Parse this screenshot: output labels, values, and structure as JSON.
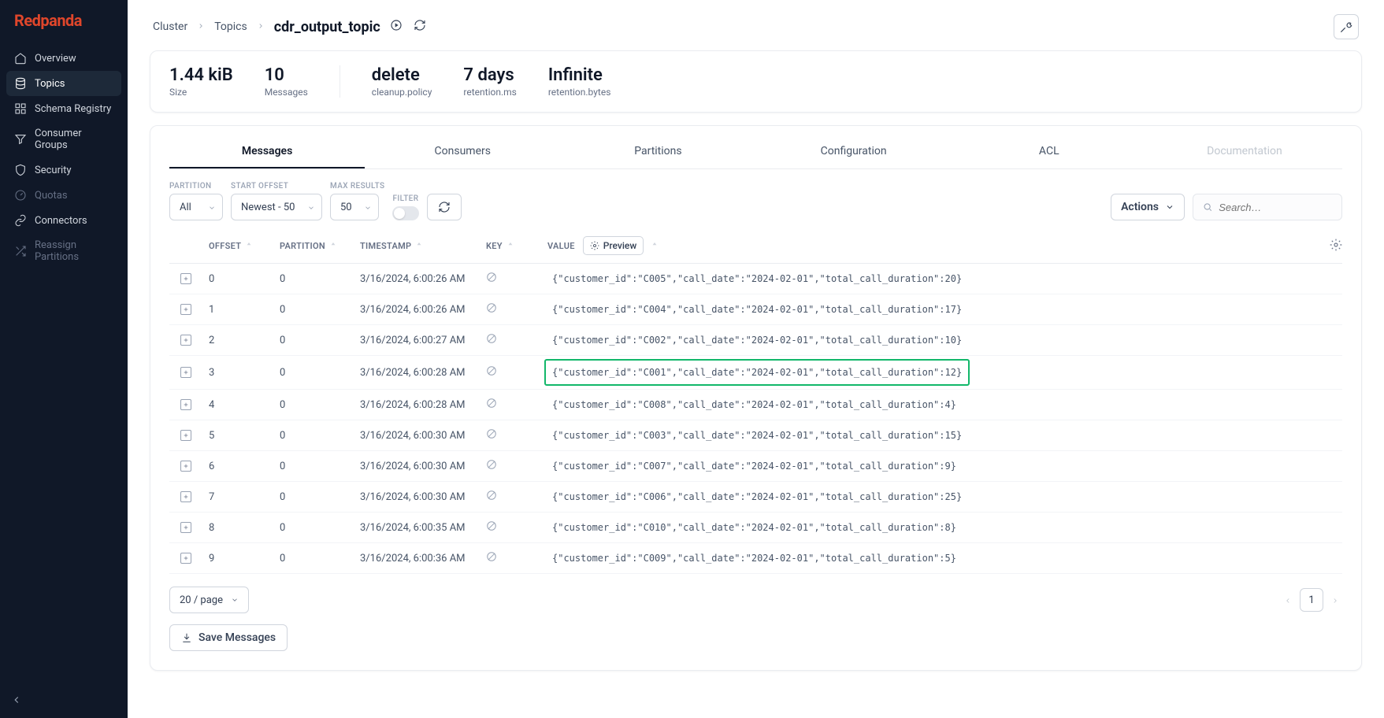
{
  "logo": "Redpanda",
  "sidebar": {
    "items": [
      {
        "label": "Overview",
        "icon": "home"
      },
      {
        "label": "Topics",
        "icon": "database",
        "active": true
      },
      {
        "label": "Schema Registry",
        "icon": "grid"
      },
      {
        "label": "Consumer Groups",
        "icon": "filter"
      },
      {
        "label": "Security",
        "icon": "shield"
      },
      {
        "label": "Quotas",
        "icon": "meter",
        "muted": true
      },
      {
        "label": "Connectors",
        "icon": "link"
      },
      {
        "label": "Reassign Partitions",
        "icon": "shuffle",
        "muted": true
      }
    ]
  },
  "breadcrumb": {
    "cluster": "Cluster",
    "topics": "Topics",
    "current": "cdr_output_topic"
  },
  "stats": [
    {
      "value": "1.44 kiB",
      "label": "Size"
    },
    {
      "value": "10",
      "label": "Messages"
    },
    {
      "value": "delete",
      "label": "cleanup.policy"
    },
    {
      "value": "7 days",
      "label": "retention.ms"
    },
    {
      "value": "Infinite",
      "label": "retention.bytes"
    }
  ],
  "tabs": [
    "Messages",
    "Consumers",
    "Partitions",
    "Configuration",
    "ACL",
    "Documentation"
  ],
  "active_tab": 0,
  "filters": {
    "partition_label": "PARTITION",
    "partition": "All",
    "start_offset_label": "START OFFSET",
    "start_offset": "Newest - 50",
    "max_results_label": "MAX RESULTS",
    "max_results": "50",
    "filter_label": "FILTER",
    "actions": "Actions",
    "search_placeholder": "Search…"
  },
  "table": {
    "headers": {
      "offset": "OFFSET",
      "partition": "PARTITION",
      "timestamp": "TIMESTAMP",
      "key": "KEY",
      "value": "VALUE",
      "preview": "Preview"
    },
    "rows": [
      {
        "offset": "0",
        "partition": "0",
        "timestamp": "3/16/2024, 6:00:26 AM",
        "value": "{\"customer_id\":\"C005\",\"call_date\":\"2024-02-01\",\"total_call_duration\":20}"
      },
      {
        "offset": "1",
        "partition": "0",
        "timestamp": "3/16/2024, 6:00:26 AM",
        "value": "{\"customer_id\":\"C004\",\"call_date\":\"2024-02-01\",\"total_call_duration\":17}"
      },
      {
        "offset": "2",
        "partition": "0",
        "timestamp": "3/16/2024, 6:00:27 AM",
        "value": "{\"customer_id\":\"C002\",\"call_date\":\"2024-02-01\",\"total_call_duration\":10}"
      },
      {
        "offset": "3",
        "partition": "0",
        "timestamp": "3/16/2024, 6:00:28 AM",
        "value": "{\"customer_id\":\"C001\",\"call_date\":\"2024-02-01\",\"total_call_duration\":12}",
        "highlight": true
      },
      {
        "offset": "4",
        "partition": "0",
        "timestamp": "3/16/2024, 6:00:28 AM",
        "value": "{\"customer_id\":\"C008\",\"call_date\":\"2024-02-01\",\"total_call_duration\":4}"
      },
      {
        "offset": "5",
        "partition": "0",
        "timestamp": "3/16/2024, 6:00:30 AM",
        "value": "{\"customer_id\":\"C003\",\"call_date\":\"2024-02-01\",\"total_call_duration\":15}"
      },
      {
        "offset": "6",
        "partition": "0",
        "timestamp": "3/16/2024, 6:00:30 AM",
        "value": "{\"customer_id\":\"C007\",\"call_date\":\"2024-02-01\",\"total_call_duration\":9}"
      },
      {
        "offset": "7",
        "partition": "0",
        "timestamp": "3/16/2024, 6:00:30 AM",
        "value": "{\"customer_id\":\"C006\",\"call_date\":\"2024-02-01\",\"total_call_duration\":25}"
      },
      {
        "offset": "8",
        "partition": "0",
        "timestamp": "3/16/2024, 6:00:35 AM",
        "value": "{\"customer_id\":\"C010\",\"call_date\":\"2024-02-01\",\"total_call_duration\":8}"
      },
      {
        "offset": "9",
        "partition": "0",
        "timestamp": "3/16/2024, 6:00:36 AM",
        "value": "{\"customer_id\":\"C009\",\"call_date\":\"2024-02-01\",\"total_call_duration\":5}"
      }
    ],
    "page_size": "20 / page",
    "page": "1",
    "save": "Save Messages"
  }
}
